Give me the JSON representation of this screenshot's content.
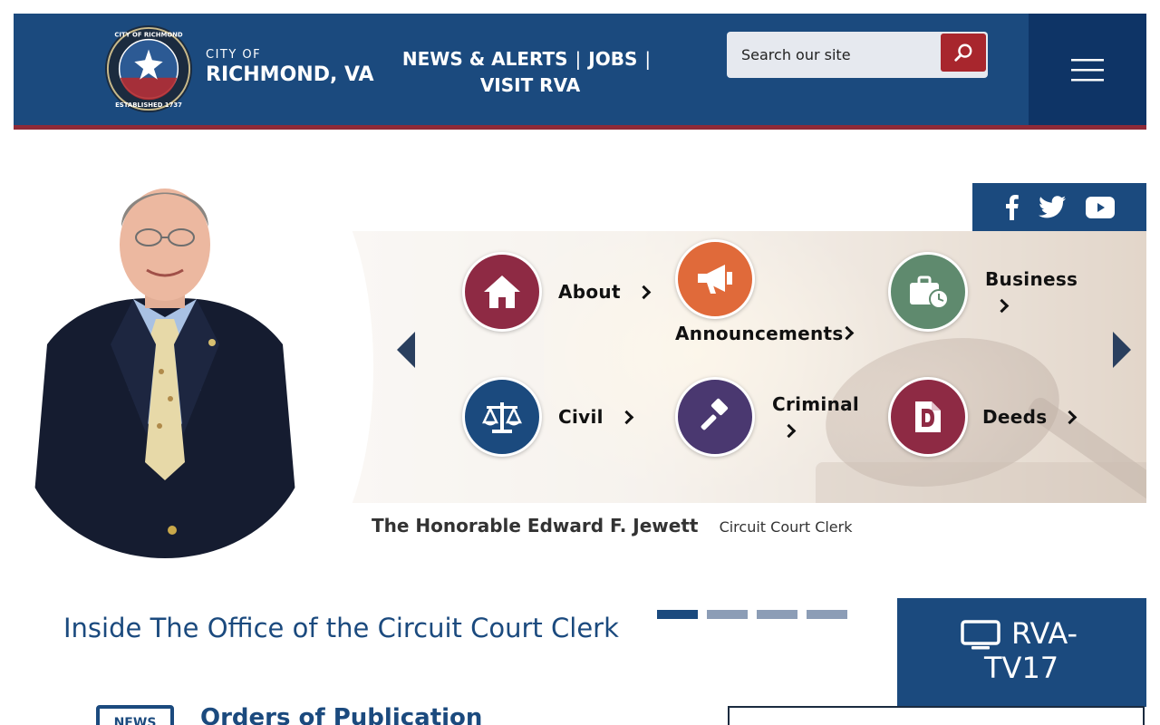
{
  "header": {
    "city_small": "CITY OF",
    "city_big": "RICHMOND, VA",
    "seal_text_top": "CITY OF RICHMOND",
    "seal_text_bottom": "ESTABLISHED 1737",
    "nav": [
      "NEWS & ALERTS",
      "JOBS",
      "VISIT RVA"
    ],
    "search_placeholder": "Search our site"
  },
  "colors": {
    "brand_blue": "#1b4a7e",
    "dark_blue": "#0e3466",
    "accent_red": "#a8262d"
  },
  "social": [
    "facebook-icon",
    "twitter-icon",
    "youtube-icon"
  ],
  "tiles": [
    {
      "label": "About",
      "color": "#8e2a44",
      "icon": "home-icon"
    },
    {
      "label": "Announcements",
      "color": "#e06a3a",
      "icon": "megaphone-icon"
    },
    {
      "label": "Business",
      "color": "#5f8a6e",
      "icon": "briefcase-clock-icon"
    },
    {
      "label": "Civil",
      "color": "#1b4a7e",
      "icon": "scales-icon"
    },
    {
      "label": "Criminal",
      "color": "#4a3870",
      "icon": "gavel-icon"
    },
    {
      "label": "Deeds",
      "color": "#8e2a44",
      "icon": "deed-document-icon"
    }
  ],
  "caption": {
    "name": "The Honorable Edward F. Jewett",
    "role": "Circuit Court Clerk"
  },
  "section": {
    "title": "Inside The Office of the Circuit Court Clerk"
  },
  "rva": {
    "label": "RVA-\nTV17",
    "line1": "RVA-",
    "line2": "TV17"
  },
  "news": {
    "badge": "NEWS",
    "link": "Orders of Publication"
  },
  "carousel": {
    "slides": 4,
    "active": 1
  }
}
